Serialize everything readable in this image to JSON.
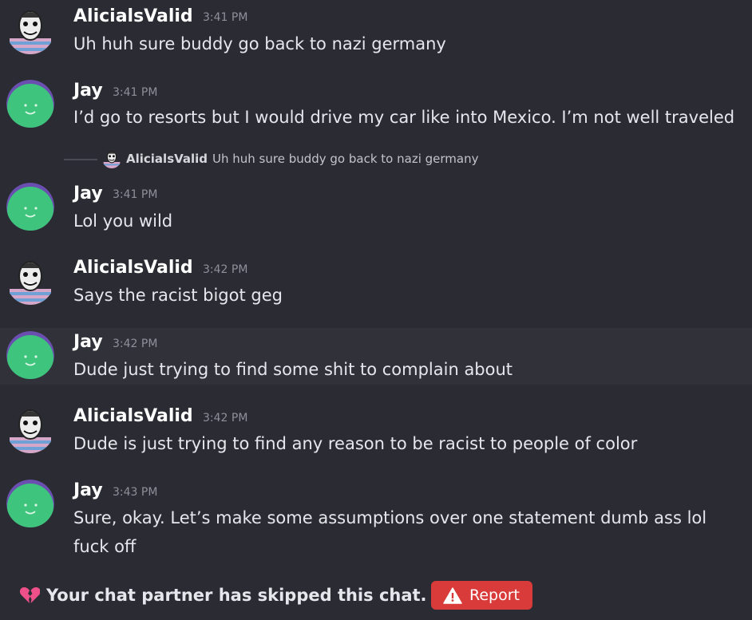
{
  "messages": [
    {
      "author": "AlicialsValid",
      "time": "3:41 PM",
      "lines": [
        "Uh huh sure buddy go back to nazi germany"
      ],
      "avatar": "alicia-avatar"
    },
    {
      "author": "Jay",
      "time": "3:41 PM",
      "lines": [
        "I’d go to resorts but I would drive my car like into Mexico. I’m not well traveled"
      ],
      "avatar": "smiley-avatar"
    },
    {
      "author": "Jay",
      "time": "3:41 PM",
      "lines": [
        "Lol you wild"
      ],
      "avatar": "smiley-avatar",
      "reply_to": {
        "author": "AlicialsValid",
        "text": "Uh huh sure buddy go back to nazi germany"
      }
    },
    {
      "author": "AlicialsValid",
      "time": "3:42 PM",
      "lines": [
        "Says the racist bigot geg"
      ],
      "avatar": "alicia-avatar"
    },
    {
      "author": "Jay",
      "time": "3:42 PM",
      "lines": [
        "Dude just trying to find some shit to complain about"
      ],
      "avatar": "smiley-avatar"
    },
    {
      "author": "AlicialsValid",
      "time": "3:42 PM",
      "lines": [
        "Dude is just trying to find any reason to be racist to people of color"
      ],
      "avatar": "alicia-avatar"
    },
    {
      "author": "Jay",
      "time": "3:43 PM",
      "lines": [
        "Sure, okay. Let’s make some assumptions over one statement dumb ass lol",
        "fuck off"
      ],
      "avatar": "smiley-avatar"
    }
  ],
  "status": {
    "icon": "broken-heart-icon",
    "text": "Your chat partner has skipped this chat.",
    "report_label": "Report",
    "report_icon": "warning-icon"
  },
  "colors": {
    "background": "#2b2c33",
    "highlight_row": "#313239",
    "report_button": "#d93a3a",
    "smiley_avatar_face": "#3ec47d",
    "smiley_avatar_ring": "#6a4fb0",
    "timestamp": "#8e9099"
  }
}
